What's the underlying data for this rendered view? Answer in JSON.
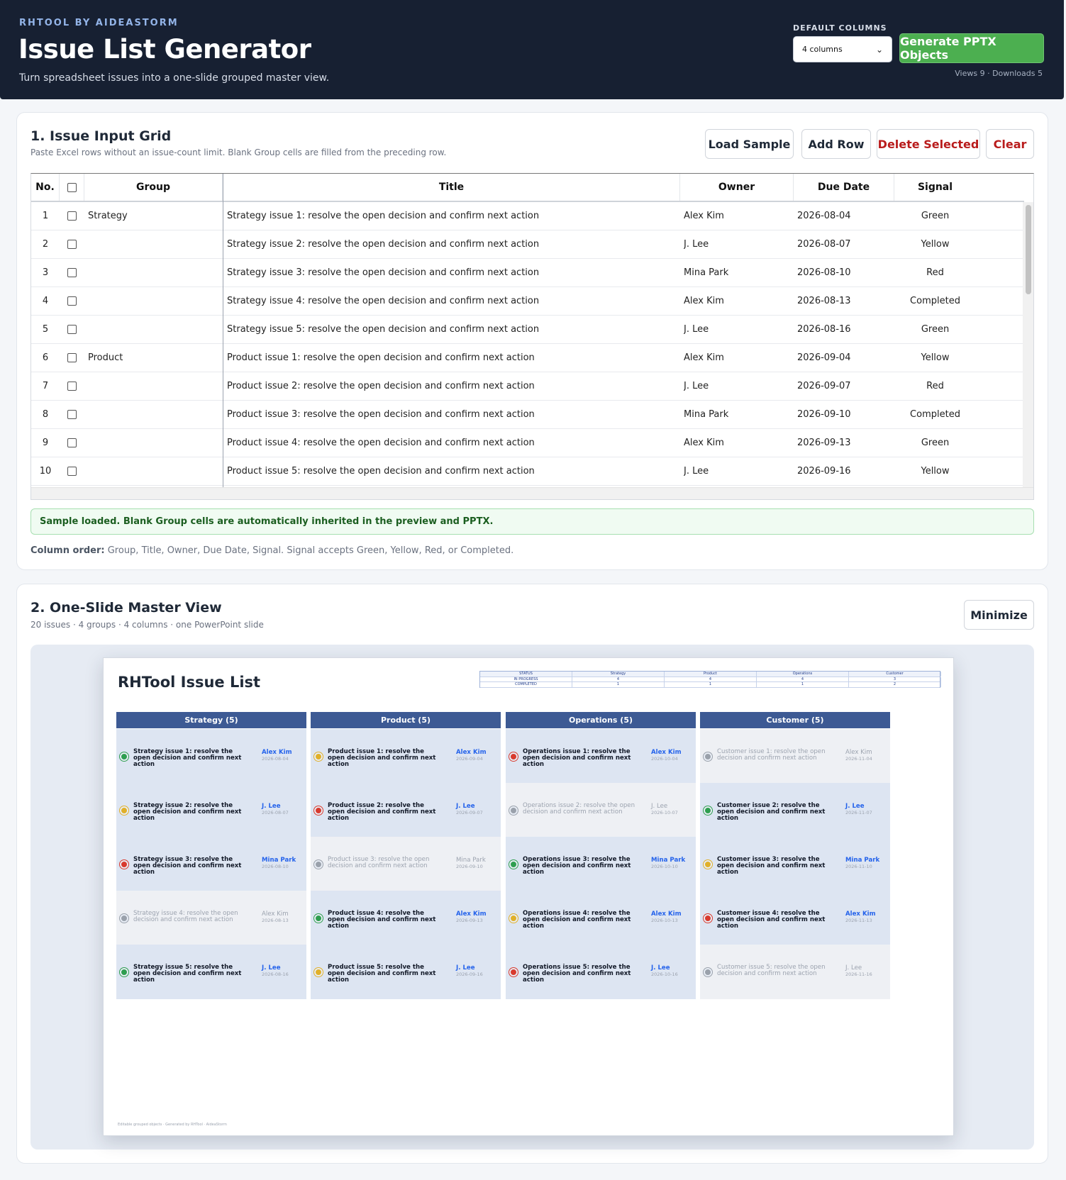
{
  "header": {
    "brand": "RHTOOL BY AIDEASTORM",
    "title": "Issue List Generator",
    "subtitle": "Turn spreadsheet issues into a one-slide grouped master view.",
    "default_columns_label": "DEFAULT COLUMNS",
    "default_columns_value": "4 columns",
    "generate_label": "Generate PPTX Objects",
    "stats": "Views 9  ·  Downloads 5"
  },
  "input": {
    "title": "1. Issue Input Grid",
    "subtitle": "Paste Excel rows without an issue-count limit. Blank Group cells are filled from the preceding row.",
    "buttons": {
      "load": "Load Sample",
      "add": "Add Row",
      "delete": "Delete Selected",
      "clear": "Clear"
    },
    "columns": [
      "No.",
      "",
      "Group",
      "Title",
      "Owner",
      "Due Date",
      "Signal"
    ],
    "rows": [
      {
        "no": "1",
        "group": "Strategy",
        "title": "Strategy issue 1: resolve the open decision and confirm next action",
        "owner": "Alex Kim",
        "due": "2026-08-04",
        "signal": "Green"
      },
      {
        "no": "2",
        "group": "",
        "title": "Strategy issue 2: resolve the open decision and confirm next action",
        "owner": "J. Lee",
        "due": "2026-08-07",
        "signal": "Yellow"
      },
      {
        "no": "3",
        "group": "",
        "title": "Strategy issue 3: resolve the open decision and confirm next action",
        "owner": "Mina Park",
        "due": "2026-08-10",
        "signal": "Red"
      },
      {
        "no": "4",
        "group": "",
        "title": "Strategy issue 4: resolve the open decision and confirm next action",
        "owner": "Alex Kim",
        "due": "2026-08-13",
        "signal": "Completed"
      },
      {
        "no": "5",
        "group": "",
        "title": "Strategy issue 5: resolve the open decision and confirm next action",
        "owner": "J. Lee",
        "due": "2026-08-16",
        "signal": "Green"
      },
      {
        "no": "6",
        "group": "Product",
        "title": "Product issue 1: resolve the open decision and confirm next action",
        "owner": "Alex Kim",
        "due": "2026-09-04",
        "signal": "Yellow"
      },
      {
        "no": "7",
        "group": "",
        "title": "Product issue 2: resolve the open decision and confirm next action",
        "owner": "J. Lee",
        "due": "2026-09-07",
        "signal": "Red"
      },
      {
        "no": "8",
        "group": "",
        "title": "Product issue 3: resolve the open decision and confirm next action",
        "owner": "Mina Park",
        "due": "2026-09-10",
        "signal": "Completed"
      },
      {
        "no": "9",
        "group": "",
        "title": "Product issue 4: resolve the open decision and confirm next action",
        "owner": "Alex Kim",
        "due": "2026-09-13",
        "signal": "Green"
      },
      {
        "no": "10",
        "group": "",
        "title": "Product issue 5: resolve the open decision and confirm next action",
        "owner": "J. Lee",
        "due": "2026-09-16",
        "signal": "Yellow"
      }
    ],
    "status_message": "Sample loaded. Blank Group cells are automatically inherited in the preview and PPTX.",
    "column_order_label": "Column order:",
    "column_order_text": "Group, Title, Owner, Due Date, Signal. Signal accepts Green, Yellow, Red, or Completed."
  },
  "preview": {
    "title": "2. One-Slide Master View",
    "subtitle": "20 issues · 4 groups · 4 columns · one PowerPoint slide",
    "minimize_label": "Minimize",
    "slide_title": "RHTool Issue List",
    "summary_table": {
      "header": [
        "STATUS",
        "Strategy",
        "Product",
        "Operations",
        "Customer"
      ],
      "rows": [
        [
          "IN PROGRESS",
          "4",
          "4",
          "4",
          "3"
        ],
        [
          "COMPLETED",
          "1",
          "1",
          "1",
          "2"
        ]
      ]
    },
    "groups": [
      {
        "label": "Strategy (5)",
        "cards": [
          {
            "title": "Strategy issue 1: resolve the open decision and confirm next action",
            "owner": "Alex Kim",
            "date": "2026-08-04",
            "signal": "green"
          },
          {
            "title": "Strategy issue 2: resolve the open decision and confirm next action",
            "owner": "J. Lee",
            "date": "2026-08-07",
            "signal": "yellow"
          },
          {
            "title": "Strategy issue 3: resolve the open decision and confirm next action",
            "owner": "Mina Park",
            "date": "2026-08-10",
            "signal": "red"
          },
          {
            "title": "Strategy issue 4: resolve the open decision and confirm next action",
            "owner": "Alex Kim",
            "date": "2026-08-13",
            "signal": "completed"
          },
          {
            "title": "Strategy issue 5: resolve the open decision and confirm next action",
            "owner": "J. Lee",
            "date": "2026-08-16",
            "signal": "green"
          }
        ]
      },
      {
        "label": "Product (5)",
        "cards": [
          {
            "title": "Product issue 1: resolve the open decision and confirm next action",
            "owner": "Alex Kim",
            "date": "2026-09-04",
            "signal": "yellow"
          },
          {
            "title": "Product issue 2: resolve the open decision and confirm next action",
            "owner": "J. Lee",
            "date": "2026-09-07",
            "signal": "red"
          },
          {
            "title": "Product issue 3: resolve the open decision and confirm next action",
            "owner": "Mina Park",
            "date": "2026-09-10",
            "signal": "completed"
          },
          {
            "title": "Product issue 4: resolve the open decision and confirm next action",
            "owner": "Alex Kim",
            "date": "2026-09-13",
            "signal": "green"
          },
          {
            "title": "Product issue 5: resolve the open decision and confirm next action",
            "owner": "J. Lee",
            "date": "2026-09-16",
            "signal": "yellow"
          }
        ]
      },
      {
        "label": "Operations (5)",
        "cards": [
          {
            "title": "Operations issue 1: resolve the open decision and confirm next action",
            "owner": "Alex Kim",
            "date": "2026-10-04",
            "signal": "red"
          },
          {
            "title": "Operations issue 2: resolve the open decision and confirm next action",
            "owner": "J. Lee",
            "date": "2026-10-07",
            "signal": "completed"
          },
          {
            "title": "Operations issue 3: resolve the open decision and confirm next action",
            "owner": "Mina Park",
            "date": "2026-10-10",
            "signal": "green"
          },
          {
            "title": "Operations issue 4: resolve the open decision and confirm next action",
            "owner": "Alex Kim",
            "date": "2026-10-13",
            "signal": "yellow"
          },
          {
            "title": "Operations issue 5: resolve the open decision and confirm next action",
            "owner": "J. Lee",
            "date": "2026-10-16",
            "signal": "red"
          }
        ]
      },
      {
        "label": "Customer (5)",
        "cards": [
          {
            "title": "Customer issue 1: resolve the open decision and confirm next action",
            "owner": "Alex Kim",
            "date": "2026-11-04",
            "signal": "completed"
          },
          {
            "title": "Customer issue 2: resolve the open decision and confirm next action",
            "owner": "J. Lee",
            "date": "2026-11-07",
            "signal": "green"
          },
          {
            "title": "Customer issue 3: resolve the open decision and confirm next action",
            "owner": "Mina Park",
            "date": "2026-11-10",
            "signal": "yellow"
          },
          {
            "title": "Customer issue 4: resolve the open decision and confirm next action",
            "owner": "Alex Kim",
            "date": "2026-11-13",
            "signal": "red"
          },
          {
            "title": "Customer issue 5: resolve the open decision and confirm next action",
            "owner": "J. Lee",
            "date": "2026-11-16",
            "signal": "completed"
          }
        ]
      }
    ],
    "footer": "Editable grouped objects · Generated by RHTool · AideaStorm",
    "signal_colors": {
      "green": "#2e9e4f",
      "yellow": "#e0b02a",
      "red": "#d83a2e",
      "completed": "#9aa1ab"
    }
  },
  "icons": {
    "select_chevron": "chevron-down-icon",
    "checkbox": "checkbox"
  },
  "colors": {
    "header_bg": "#172032",
    "accent_green": "#4caf50",
    "slide_header": "#3d5a94"
  }
}
